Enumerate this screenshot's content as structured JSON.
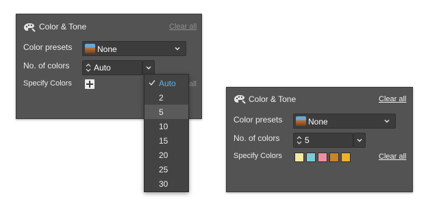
{
  "left_panel": {
    "title": "Color & Tone",
    "clear_all": "Clear all",
    "presets_label": "Color presets",
    "presets_value": "None",
    "num_colors_label": "No. of colors",
    "num_colors_value": "Auto",
    "specify_label": "Specify Colors",
    "clear_all_partial": "all",
    "icons": [
      "palette-icon",
      "chevron-down-icon",
      "stepper-icon",
      "plus-icon"
    ]
  },
  "dropdown": {
    "options": [
      "Auto",
      "2",
      "5",
      "10",
      "15",
      "20",
      "25",
      "30"
    ],
    "selected": "Auto",
    "hovered": "5"
  },
  "right_panel": {
    "title": "Color & Tone",
    "clear_all": "Clear all",
    "presets_label": "Color presets",
    "presets_value": "None",
    "num_colors_label": "No. of colors",
    "num_colors_value": "5",
    "specify_label": "Specify Colors",
    "specify_clear": "Clear all",
    "swatches": [
      "#f6e7a1",
      "#7fc9d6",
      "#ef8ea0",
      "#c9832a",
      "#efb12a"
    ]
  },
  "colors": {
    "panel_bg": "#535353",
    "field_bg": "#3c3c3c",
    "selected_option": "#5fb2ea"
  }
}
